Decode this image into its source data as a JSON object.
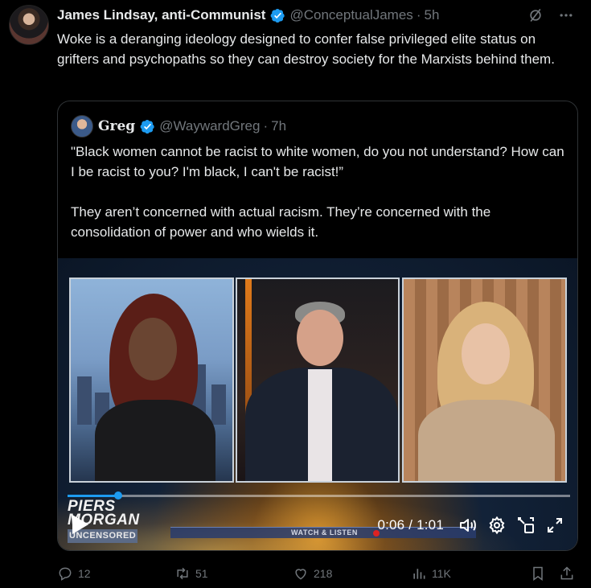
{
  "tweet": {
    "author_name": "James Lindsay, anti-Communist",
    "handle": "@ConceptualJames",
    "separator": "·",
    "time": "5h",
    "text": "Woke is a deranging ideology designed to confer false privileged elite status on grifters and psychopaths so they can destroy society for the Marxists behind them."
  },
  "quote": {
    "author_name": "Greg",
    "handle": "@WaywardGreg",
    "separator": "·",
    "time": "7h",
    "paragraph_1": "\"Black women cannot be racist to white women, do you not understand? How can I be racist to you? I'm black, I can't be racist!”",
    "paragraph_2": "They aren’t concerned with actual racism. They’re concerned with the consolidation of power and who wields it."
  },
  "video": {
    "brand_line_1": "PIERS",
    "brand_line_2": "MORGAN",
    "brand_line_3": "UNCENSORED",
    "ticker_text": "WATCH & LISTEN",
    "time_display": "0:06 / 1:01",
    "progress_fraction": 0.1
  },
  "actions": {
    "replies": "12",
    "reposts": "51",
    "likes": "218",
    "views": "11K"
  },
  "colors": {
    "accent": "#1d9bf0",
    "text_primary": "#e7e9ea",
    "text_secondary": "#71767b",
    "background": "#000000"
  }
}
